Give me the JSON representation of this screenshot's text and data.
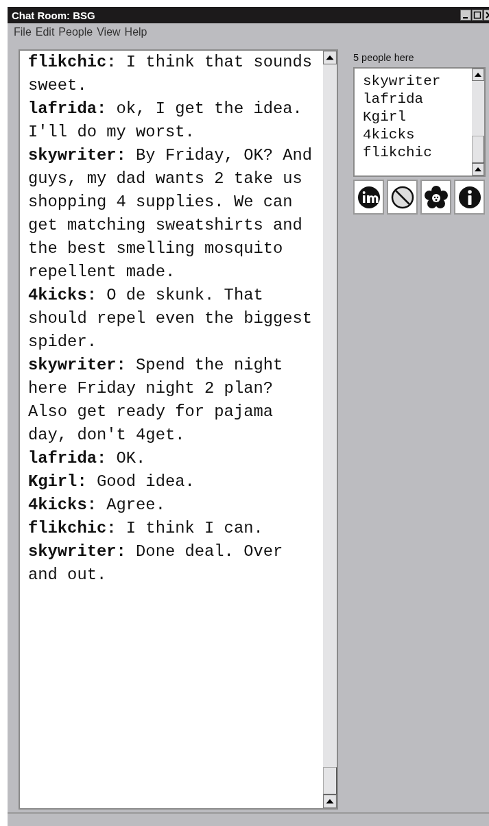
{
  "window": {
    "title": "Chat Room: BSG"
  },
  "menu": [
    "File",
    "Edit",
    "People",
    "View",
    "Help"
  ],
  "messages": [
    {
      "name": "flikchic:",
      "text": "I think that sounds sweet."
    },
    {
      "name": "lafrida:",
      "text": "ok, I get the idea. I'll do my worst."
    },
    {
      "name": "skywriter:",
      "text": "By Friday, OK? And guys, my dad wants 2 take us shopping 4 supplies. We can get matching sweatshirts and the best smelling mosquito repellent made."
    },
    {
      "name": "4kicks:",
      "text": "O de skunk. That should repel even the biggest spider."
    },
    {
      "name": "skywriter:",
      "text": "Spend the night here Friday night 2 plan? Also get ready for pajama day, don't 4get."
    },
    {
      "name": "lafrida:",
      "text": "OK."
    },
    {
      "name": "Kgirl:",
      "text": "Good idea."
    },
    {
      "name": "4kicks:",
      "text": "Agree."
    },
    {
      "name": "flikchic:",
      "text": "I think I can."
    },
    {
      "name": "skywriter:",
      "text": "Done deal. Over and out."
    }
  ],
  "people": {
    "header": "5 people here",
    "names": [
      "skywriter",
      "lafrida",
      "Kgirl",
      "4kicks",
      "flikchic"
    ]
  }
}
